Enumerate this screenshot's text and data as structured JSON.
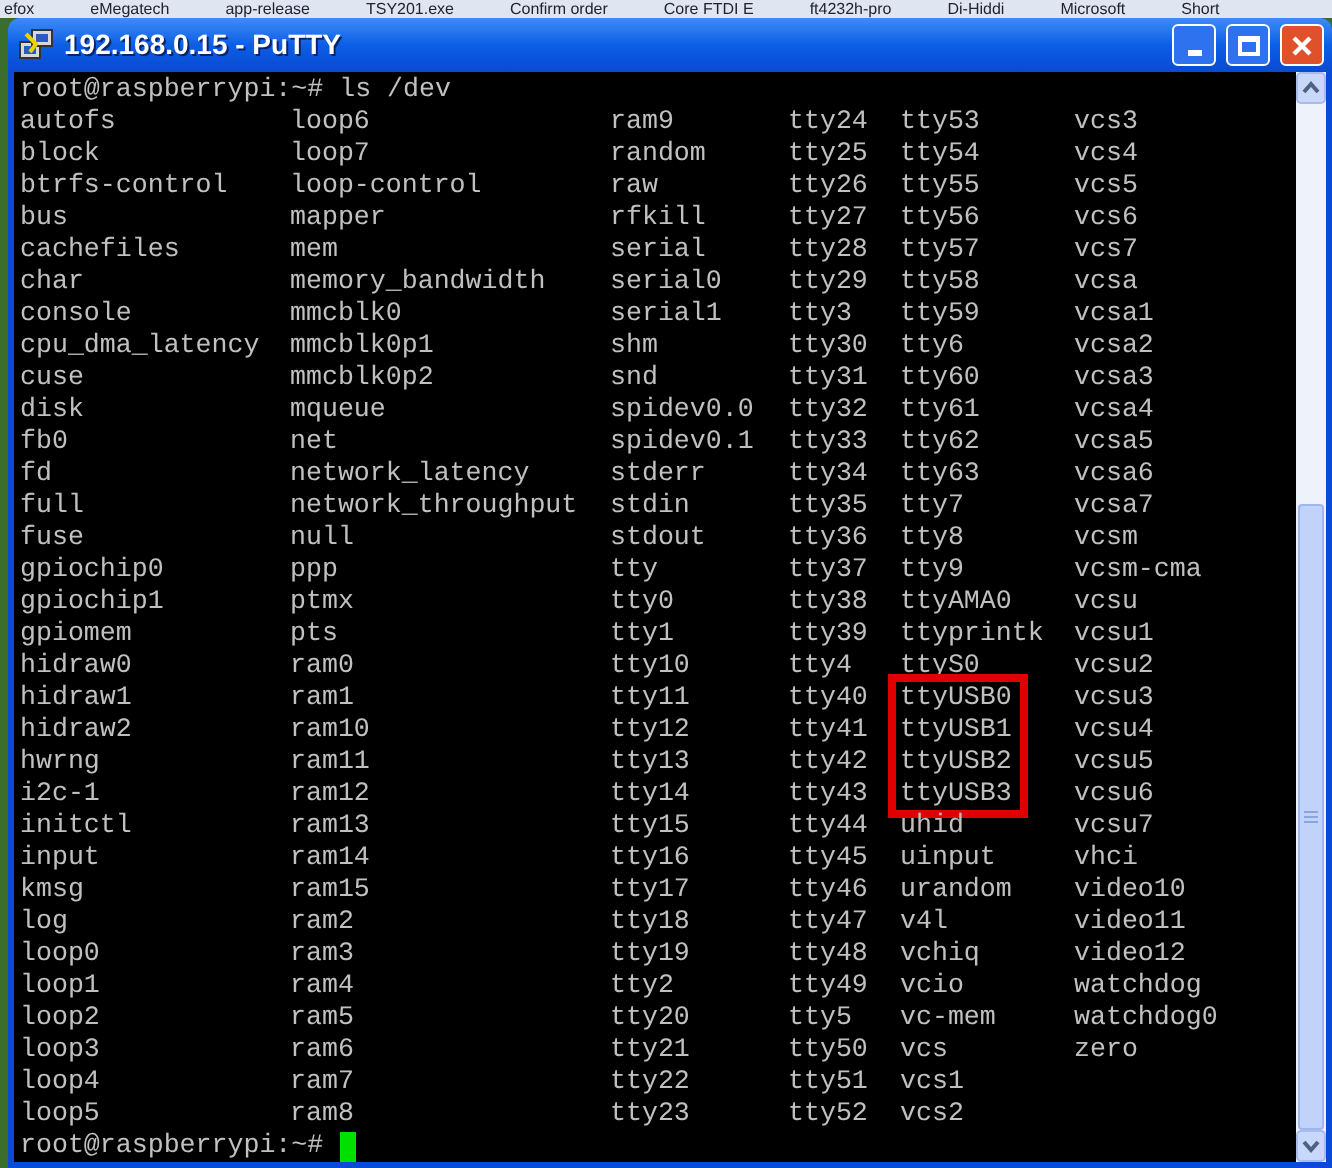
{
  "background_window_tabs": [
    "efox",
    "eMegatech",
    "app-release",
    "TSY201.exe",
    "Confirm order",
    "Core FTDI E",
    "ft4232h-pro",
    "Di-Hiddi",
    "Microsoft",
    "Short"
  ],
  "window": {
    "title": "192.168.0.15 - PuTTY"
  },
  "terminal": {
    "command_line": "root@raspberrypi:~# ls /dev",
    "columns": [
      {
        "groups": [
          {
            "outlined": false,
            "entries": [
              "autofs",
              "block",
              "btrfs-control",
              "bus",
              "cachefiles",
              "char",
              "console",
              "cpu_dma_latency",
              "cuse",
              "disk",
              "fb0",
              "fd",
              "full",
              "fuse",
              "gpiochip0",
              "gpiochip1",
              "gpiomem",
              "hidraw0",
              "hidraw1",
              "hidraw2",
              "hwrng",
              "i2c-1",
              "initctl",
              "input",
              "kmsg",
              "log",
              "loop0",
              "loop1",
              "loop2",
              "loop3",
              "loop4",
              "loop5"
            ]
          }
        ]
      },
      {
        "groups": [
          {
            "outlined": false,
            "entries": [
              "loop6",
              "loop7",
              "loop-control",
              "mapper",
              "mem",
              "memory_bandwidth",
              "mmcblk0",
              "mmcblk0p1",
              "mmcblk0p2",
              "mqueue",
              "net",
              "network_latency",
              "network_throughput",
              "null",
              "ppp",
              "ptmx",
              "pts",
              "ram0",
              "ram1",
              "ram10",
              "ram11",
              "ram12",
              "ram13",
              "ram14",
              "ram15",
              "ram2",
              "ram3",
              "ram4",
              "ram5",
              "ram6",
              "ram7",
              "ram8"
            ]
          }
        ]
      },
      {
        "groups": [
          {
            "outlined": false,
            "entries": [
              "ram9",
              "random",
              "raw",
              "rfkill",
              "serial",
              "serial0",
              "serial1",
              "shm",
              "snd",
              "spidev0.0",
              "spidev0.1",
              "stderr",
              "stdin",
              "stdout",
              "tty",
              "tty0",
              "tty1",
              "tty10",
              "tty11",
              "tty12",
              "tty13",
              "tty14",
              "tty15",
              "tty16",
              "tty17",
              "tty18",
              "tty19",
              "tty2",
              "tty20",
              "tty21",
              "tty22",
              "tty23"
            ]
          }
        ]
      },
      {
        "groups": [
          {
            "outlined": false,
            "entries": [
              "tty24",
              "tty25",
              "tty26",
              "tty27",
              "tty28",
              "tty29",
              "tty3",
              "tty30",
              "tty31",
              "tty32",
              "tty33",
              "tty34",
              "tty35",
              "tty36",
              "tty37",
              "tty38",
              "tty39",
              "tty4",
              "tty40",
              "tty41",
              "tty42",
              "tty43",
              "tty44",
              "tty45",
              "tty46",
              "tty47",
              "tty48",
              "tty49",
              "tty5",
              "tty50",
              "tty51",
              "tty52"
            ]
          }
        ]
      },
      {
        "groups": [
          {
            "outlined": false,
            "entries": [
              "tty53",
              "tty54",
              "tty55",
              "tty56",
              "tty57",
              "tty58",
              "tty59",
              "tty6",
              "tty60",
              "tty61",
              "tty62",
              "tty63",
              "tty7",
              "tty8",
              "tty9",
              "ttyAMA0",
              "ttyprintk",
              "ttyS0"
            ]
          },
          {
            "outlined": true,
            "entries": [
              "ttyUSB0",
              "ttyUSB1",
              "ttyUSB2",
              "ttyUSB3"
            ]
          },
          {
            "outlined": false,
            "entries": [
              "uhid",
              "uinput",
              "urandom",
              "v4l",
              "vchiq",
              "vcio",
              "vc-mem",
              "vcs",
              "vcs1",
              "vcs2"
            ]
          }
        ]
      },
      {
        "groups": [
          {
            "outlined": false,
            "entries": [
              "vcs3",
              "vcs4",
              "vcs5",
              "vcs6",
              "vcs7",
              "vcsa",
              "vcsa1",
              "vcsa2",
              "vcsa3",
              "vcsa4",
              "vcsa5",
              "vcsa6",
              "vcsa7",
              "vcsm",
              "vcsm-cma",
              "vcsu",
              "vcsu1",
              "vcsu2",
              "vcsu3",
              "vcsu4",
              "vcsu5",
              "vcsu6",
              "vcsu7",
              "vhci",
              "video10",
              "video11",
              "video12",
              "watchdog",
              "watchdog0",
              "zero"
            ]
          }
        ]
      }
    ],
    "prompt": "root@raspberrypi:~#"
  }
}
